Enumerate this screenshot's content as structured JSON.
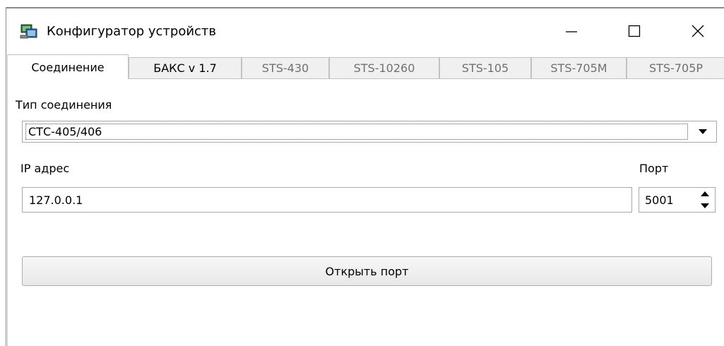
{
  "window": {
    "title": "Конфигуратор устройств"
  },
  "tabs": [
    {
      "label": "Соединение",
      "active": true
    },
    {
      "label": "БАКС v 1.7",
      "active": false
    },
    {
      "label": "STS-430",
      "active": false
    },
    {
      "label": "STS-10260",
      "active": false
    },
    {
      "label": "STS-105",
      "active": false
    },
    {
      "label": "STS-705M",
      "active": false
    },
    {
      "label": "STS-705P",
      "active": false
    }
  ],
  "connection": {
    "type_label": "Тип соединения",
    "type_value": "СТС-405/406",
    "ip_label": "IP адрес",
    "ip_value": "127.0.0.1",
    "port_label": "Порт",
    "port_value": "5001",
    "open_port_label": "Открыть порт"
  },
  "icons": {
    "app": "app-computer-icon",
    "minimize": "minimize-icon",
    "maximize": "maximize-icon",
    "close": "close-icon",
    "dropdown": "chevron-down-icon",
    "spin_up": "spin-up-icon",
    "spin_down": "spin-down-icon"
  }
}
